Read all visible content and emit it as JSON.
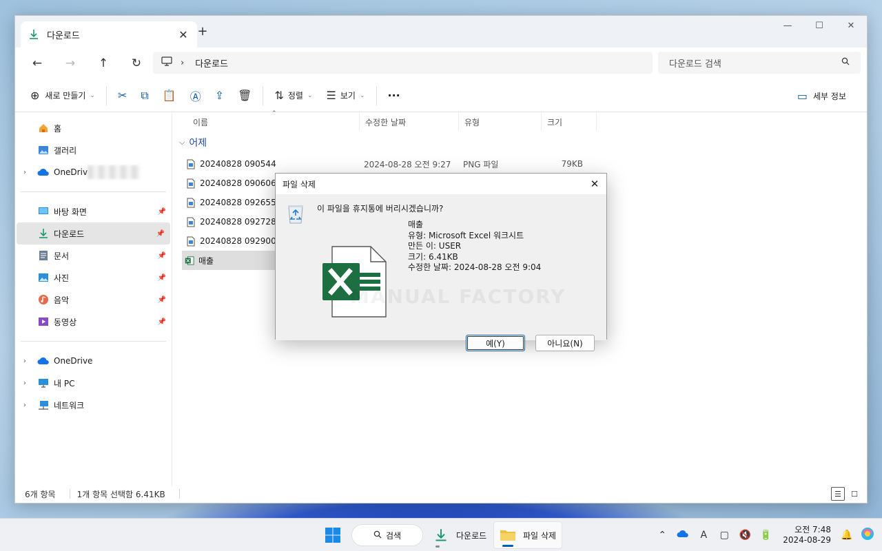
{
  "titlebar": {
    "tab_label": "다운로드",
    "tab_close": "✕",
    "new_tab": "+",
    "window_controls": {
      "minimize": "—",
      "maximize": "☐",
      "close": "✕"
    }
  },
  "address": {
    "path_separator": "›",
    "path_segment": "다운로드",
    "search_placeholder": "다운로드 검색"
  },
  "toolbar": {
    "new_label": "새로 만들기",
    "sort_label": "정렬",
    "view_label": "보기",
    "more_label": "···",
    "details_label": "세부 정보"
  },
  "sidebar": {
    "items_quick": [
      {
        "label": "홈",
        "icon": "home-icon",
        "pinned": false
      },
      {
        "label": "갤러리",
        "icon": "gallery-icon",
        "pinned": false
      },
      {
        "label": "OneDriv",
        "icon": "cloud-icon",
        "pinned": false
      }
    ],
    "items_pinned": [
      {
        "label": "바탕 화면",
        "icon": "desktop-icon"
      },
      {
        "label": "다운로드",
        "icon": "download-icon"
      },
      {
        "label": "문서",
        "icon": "document-icon"
      },
      {
        "label": "사진",
        "icon": "pictures-icon"
      },
      {
        "label": "음악",
        "icon": "music-icon"
      },
      {
        "label": "동영상",
        "icon": "video-icon"
      }
    ],
    "items_bottom": [
      {
        "label": "OneDrive",
        "icon": "cloud-icon"
      },
      {
        "label": "내 PC",
        "icon": "pc-icon"
      },
      {
        "label": "네트워크",
        "icon": "network-icon"
      }
    ]
  },
  "filelist": {
    "columns": [
      "이름",
      "수정한 날짜",
      "유형",
      "크기"
    ],
    "group_label": "어제",
    "rows": [
      {
        "name": "20240828 090544",
        "date": "2024-08-28 오전 9:27",
        "type": "PNG 파일",
        "size": "79KB"
      },
      {
        "name": "20240828 090606",
        "date": "",
        "type": "",
        "size": ""
      },
      {
        "name": "20240828 092655",
        "date": "",
        "type": "",
        "size": ""
      },
      {
        "name": "20240828 092728",
        "date": "",
        "type": "",
        "size": ""
      },
      {
        "name": "20240828 092900",
        "date": "",
        "type": "",
        "size": ""
      },
      {
        "name": "매출",
        "date": "",
        "type": "",
        "size": ""
      }
    ]
  },
  "statusbar": {
    "count": "6개 항목",
    "selection": "1개 항목 선택함 6.41KB"
  },
  "dialog": {
    "title": "파일 삭제",
    "close": "✕",
    "question": "이 파일을 휴지통에 버리시겠습니까?",
    "file_name": "매출",
    "file_type": "유형: Microsoft Excel 워크시트",
    "author": "만든 이: USER",
    "size": "크기: 6.41KB",
    "modified": "수정한 날짜: 2024-08-28 오전 9:04",
    "watermark": "MANUAL FACTORY",
    "yes_label": "예(Y)",
    "no_label": "아니요(N)"
  },
  "taskbar": {
    "search_label": "검색",
    "apps": [
      {
        "label": "다운로드",
        "active": false
      },
      {
        "label": "파일 삭제",
        "active": true
      }
    ],
    "clock_time": "오전 7:48",
    "clock_date": "2024-08-29"
  },
  "colors": {
    "accent": "#005fb8",
    "excel_green": "#1d6f42",
    "folder_yellow": "#f0c043"
  }
}
